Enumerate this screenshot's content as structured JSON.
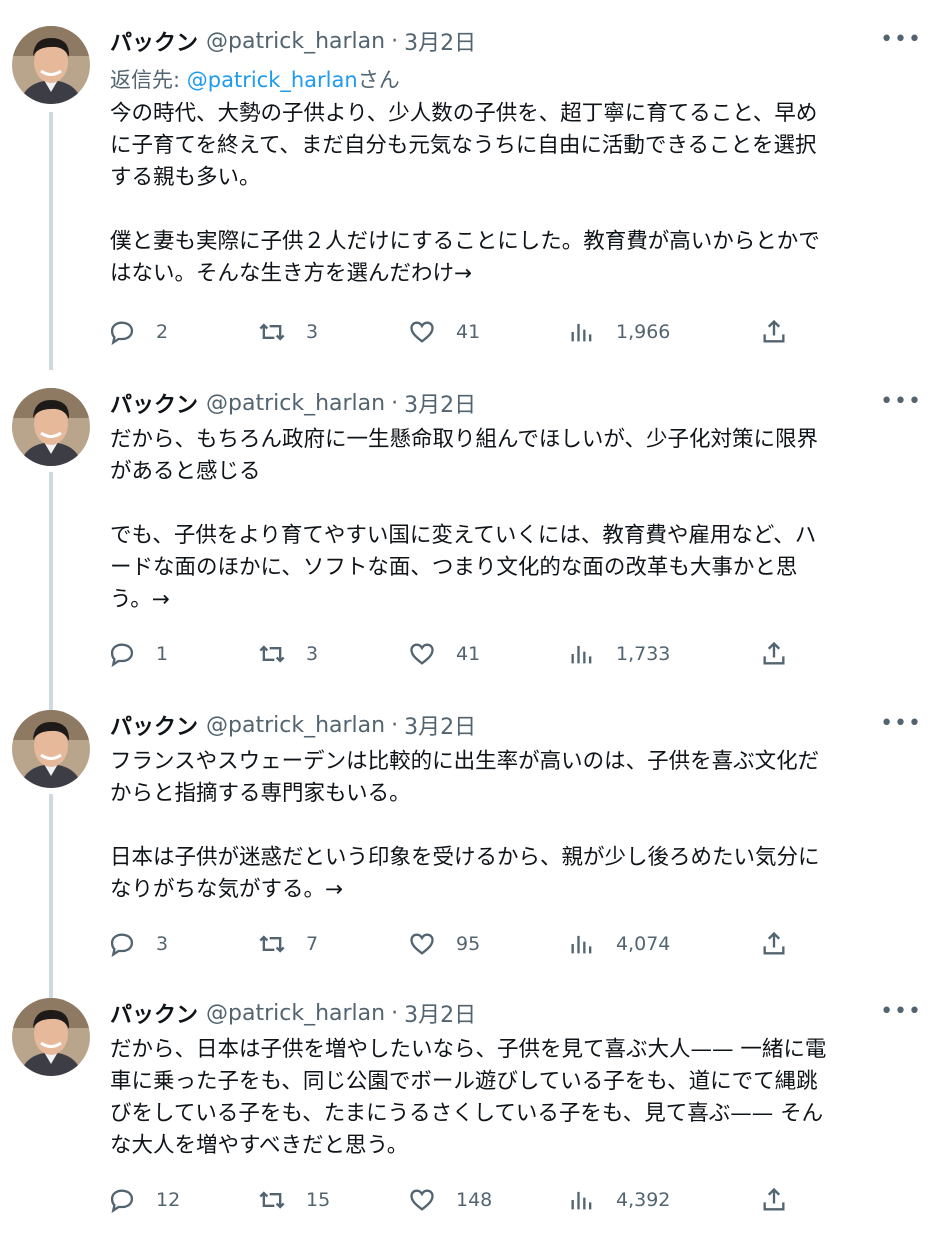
{
  "tweets": [
    {
      "name": "パックン",
      "handle": "@patrick_harlan",
      "separator": "·",
      "date": "3月2日",
      "more": "•••",
      "replying_prefix": "返信先: ",
      "replying_to": "@patrick_harlan",
      "replying_suffix": "さん",
      "paragraphs": [
        "今の時代、大勢の子供より、少人数の子供を、超丁寧に育てること、早め\nに子育てを終えて、まだ自分も元気なうちに自由に活動できることを選択\nする親も多い。",
        "僕と妻も実際に子供２人だけにすることにした。教育費が高いからとかで\nはない。そんな生き方を選んだわけ→"
      ],
      "replies": "2",
      "retweets": "3",
      "likes": "41",
      "views": "1,966"
    },
    {
      "name": "パックン",
      "handle": "@patrick_harlan",
      "separator": "·",
      "date": "3月2日",
      "more": "•••",
      "paragraphs": [
        "だから、もちろん政府に一生懸命取り組んでほしいが、少子化対策に限界\nがあると感じる",
        "でも、子供をより育てやすい国に変えていくには、教育費や雇用など、ハ\nードな面のほかに、ソフトな面、つまり文化的な面の改革も大事かと思\nう。→"
      ],
      "replies": "1",
      "retweets": "3",
      "likes": "41",
      "views": "1,733"
    },
    {
      "name": "パックン",
      "handle": "@patrick_harlan",
      "separator": "·",
      "date": "3月2日",
      "more": "•••",
      "paragraphs": [
        "フランスやスウェーデンは比較的に出生率が高いのは、子供を喜ぶ文化だ\nからと指摘する専門家もいる。",
        "日本は子供が迷惑だという印象を受けるから、親が少し後ろめたい気分に\nなりがちな気がする。→"
      ],
      "replies": "3",
      "retweets": "7",
      "likes": "95",
      "views": "4,074"
    },
    {
      "name": "パックン",
      "handle": "@patrick_harlan",
      "separator": "·",
      "date": "3月2日",
      "more": "•••",
      "paragraphs": [
        "だから、日本は子供を増やしたいなら、子供を見て喜ぶ大人—— 一緒に電\n車に乗った子をも、同じ公園でボール遊びしている子をも、道にでて縄跳\nびをしている子をも、たまにうるさくしている子をも、見て喜ぶ—— そん\nな大人を増やすべきだと思う。"
      ],
      "replies": "12",
      "retweets": "15",
      "likes": "148",
      "views": "4,392"
    }
  ],
  "icons": {
    "reply": "reply-icon",
    "retweet": "retweet-icon",
    "like": "heart-icon",
    "views": "views-icon",
    "share": "share-icon"
  },
  "colors": {
    "text": "#0f1419",
    "secondary": "#536471",
    "link": "#1d9bf0",
    "thread_line": "#cfd9de"
  }
}
